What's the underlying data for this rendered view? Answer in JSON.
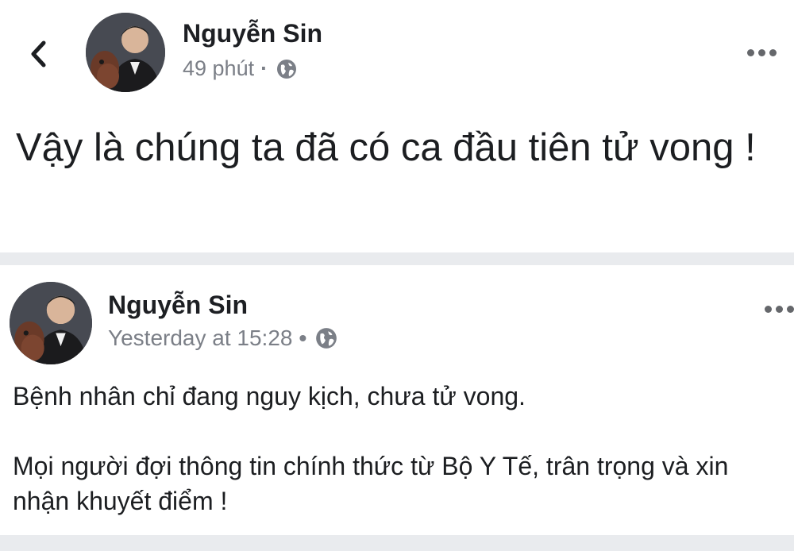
{
  "posts": [
    {
      "author": "Nguyễn Sin",
      "time": "49 phút",
      "separator": "·",
      "privacy_icon": "globe-icon",
      "body": "Vậy là chúng ta đã có ca đầu tiên tử vong !"
    },
    {
      "author": "Nguyễn Sin",
      "time": "Yesterday at 15:28",
      "separator": "•",
      "privacy_icon": "globe-icon",
      "paragraphs": [
        "Bệnh nhân chỉ đang nguy kịch, chưa tử vong.",
        "Mọi người đợi thông tin chính thức từ Bộ Y Tế, trân trọng và xin nhận khuyết điểm !"
      ]
    }
  ],
  "icons": {
    "back": "chevron-left-icon",
    "more": "more-horizontal-icon"
  },
  "colors": {
    "background": "#e9ebee",
    "card": "#ffffff",
    "meta_text": "#7b7f87"
  }
}
